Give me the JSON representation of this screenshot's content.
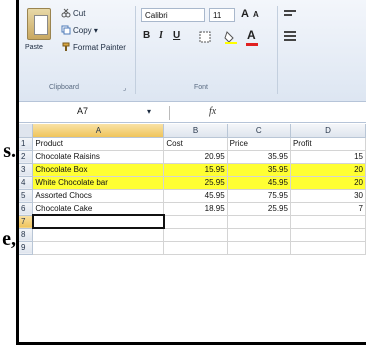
{
  "ribbon": {
    "clipboard": {
      "paste_label": "Paste",
      "cut_label": "Cut",
      "copy_label": "Copy ▾",
      "format_painter_label": "Format Painter",
      "group_label": "Clipboard"
    },
    "font": {
      "font_name": "Calibri",
      "font_size": "11",
      "bold": "B",
      "italic": "I",
      "underline": "U",
      "group_label": "Font",
      "grow": "A",
      "shrink": "A",
      "font_color": "A"
    }
  },
  "formula_bar": {
    "name_box": "A7",
    "fx": "fx",
    "content": ""
  },
  "sheet": {
    "columns": [
      "A",
      "B",
      "C",
      "D"
    ],
    "rows": [
      {
        "num": "1",
        "cells": [
          "Product",
          "Cost",
          "Price",
          "Profit"
        ],
        "highlight": false
      },
      {
        "num": "2",
        "cells": [
          "Chocolate Raisins",
          "20.95",
          "35.95",
          "15"
        ],
        "highlight": false
      },
      {
        "num": "3",
        "cells": [
          "Chocolate Box",
          "15.95",
          "35.95",
          "20"
        ],
        "highlight": true
      },
      {
        "num": "4",
        "cells": [
          "White Chocolate bar",
          "25.95",
          "45.95",
          "20"
        ],
        "highlight": true
      },
      {
        "num": "5",
        "cells": [
          "Assorted Chocs",
          "45.95",
          "75.95",
          "30"
        ],
        "highlight": false
      },
      {
        "num": "6",
        "cells": [
          "Chocolate Cake",
          "18.95",
          "25.95",
          "7"
        ],
        "highlight": false
      },
      {
        "num": "7",
        "cells": [
          "",
          "",
          "",
          ""
        ],
        "highlight": false
      },
      {
        "num": "8",
        "cells": [
          "",
          "",
          "",
          ""
        ],
        "highlight": false
      },
      {
        "num": "9",
        "cells": [
          "",
          "",
          "",
          ""
        ],
        "highlight": false
      }
    ],
    "highlight_color": "#ffff33",
    "selected_cell": "A7"
  },
  "left_fragments": [
    "s.",
    "e,"
  ]
}
